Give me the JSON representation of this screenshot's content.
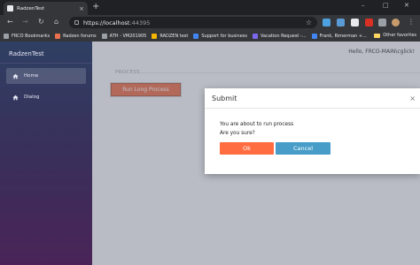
{
  "browser": {
    "tab": {
      "title": "RadzenTest",
      "close_icon": "×"
    },
    "new_tab_icon": "+",
    "window_controls": {
      "minimize": "–",
      "maximize": "□",
      "close": "✕"
    },
    "nav": {
      "back": "←",
      "forward": "→",
      "reload": "↻",
      "home": "⌂"
    },
    "url": {
      "main": "https://localhost",
      "port": ":44395"
    },
    "bookmarks": [
      {
        "label": "FRCO Bookmarks",
        "color": "#9aa0a6"
      },
      {
        "label": "Radzen forums",
        "color": "#e8704e"
      },
      {
        "label": "ATH - VM201905",
        "color": "#9aa0a6"
      },
      {
        "label": "RADZEN test",
        "color": "#f4b400"
      },
      {
        "label": "Support for business",
        "color": "#4285f4"
      },
      {
        "label": "Vacation Request -...",
        "color": "#7b68ee"
      },
      {
        "label": "Frank, Rimerman +...",
        "color": "#4285f4"
      }
    ],
    "other_bookmarks": "Other favorites"
  },
  "app": {
    "brand": "RadzenTest",
    "nav": [
      {
        "label": "Home",
        "icon": "home-icon",
        "active": true
      },
      {
        "label": "Dialog",
        "icon": "home-icon",
        "active": false
      }
    ],
    "greeting": "Hello, FRCO-MAIN\\cglick!",
    "process_legend": "PROCESS",
    "run_button": "Run Long Process"
  },
  "dialog": {
    "title": "Submit",
    "close_icon": "×",
    "message": "You are about to run process",
    "question": "Are you sure?",
    "ok_label": "Ok",
    "cancel_label": "Cancel"
  },
  "colors": {
    "ok": "#ff6d41",
    "cancel": "#479cc8",
    "run": "#e8704e",
    "sidebar_top": "#2f3f63",
    "sidebar_bottom": "#4a2458"
  }
}
